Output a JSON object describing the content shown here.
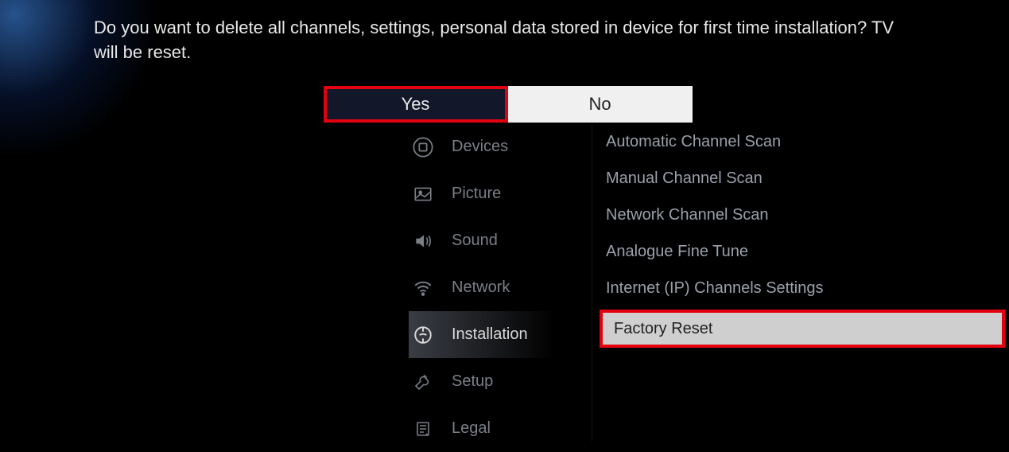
{
  "dialog": {
    "message": "Do you want to delete all channels, settings, personal data stored in device for first time installation? TV will be reset.",
    "yes": "Yes",
    "no": "No"
  },
  "menu": {
    "items": [
      {
        "label": "Devices"
      },
      {
        "label": "Picture"
      },
      {
        "label": "Sound"
      },
      {
        "label": "Network"
      },
      {
        "label": "Installation"
      },
      {
        "label": "Setup"
      },
      {
        "label": "Legal"
      }
    ]
  },
  "submenu": {
    "items": [
      {
        "label": "Automatic Channel Scan"
      },
      {
        "label": "Manual Channel Scan"
      },
      {
        "label": "Network Channel Scan"
      },
      {
        "label": "Analogue Fine Tune"
      },
      {
        "label": "Internet (IP) Channels Settings"
      },
      {
        "label": "Factory Reset"
      }
    ]
  }
}
